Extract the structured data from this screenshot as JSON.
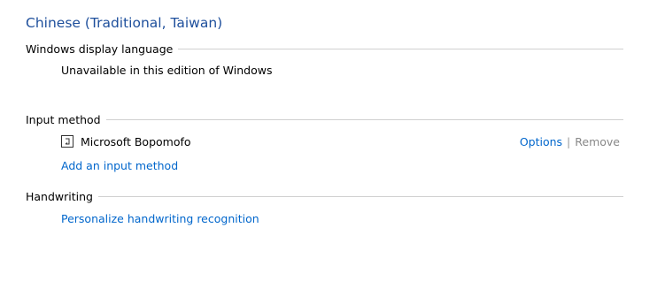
{
  "page": {
    "title": "Chinese (Traditional, Taiwan)"
  },
  "display_language": {
    "heading": "Windows display language",
    "status": "Unavailable in this edition of Windows"
  },
  "input_method": {
    "heading": "Input method",
    "item": {
      "icon": "ime-icon",
      "name": "Microsoft Bopomofo",
      "options_label": "Options",
      "separator": "|",
      "remove_label": "Remove"
    },
    "add_label": "Add an input method"
  },
  "handwriting": {
    "heading": "Handwriting",
    "personalize_label": "Personalize handwriting recognition"
  },
  "colors": {
    "title": "#1e4f9c",
    "link": "#0066cc",
    "disabled": "#888888",
    "rule": "#d0d0d0"
  }
}
